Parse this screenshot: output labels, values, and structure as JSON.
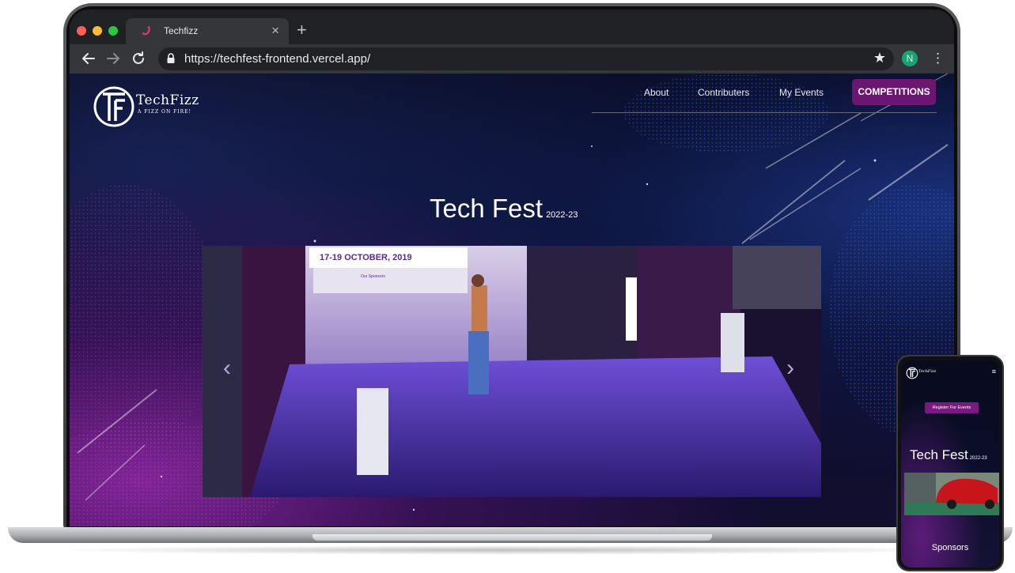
{
  "browser": {
    "tab_title": "Techfizz",
    "url": "https://techfest-frontend.vercel.app/",
    "profile_initial": "N"
  },
  "site": {
    "logo_name": "TechFizz",
    "logo_tagline": "A FIZZ ON FIRE!",
    "nav": [
      "About",
      "Contributers",
      "My Events"
    ],
    "cta": "COMPETITIONS",
    "hero_title": "Tech Fest",
    "hero_year": "2022-23",
    "banner_date": "17-19 OCTOBER, 2019",
    "banner_sponsors": "Our Sponsors"
  },
  "mobile": {
    "logo_name": "TechFizz",
    "register_button": "Register For Events",
    "hero_title": "Tech Fest",
    "hero_year": "2022-23",
    "sponsors_heading": "Sponsors"
  },
  "colors": {
    "accent": "#6b1670",
    "background": "#0a0d26"
  }
}
